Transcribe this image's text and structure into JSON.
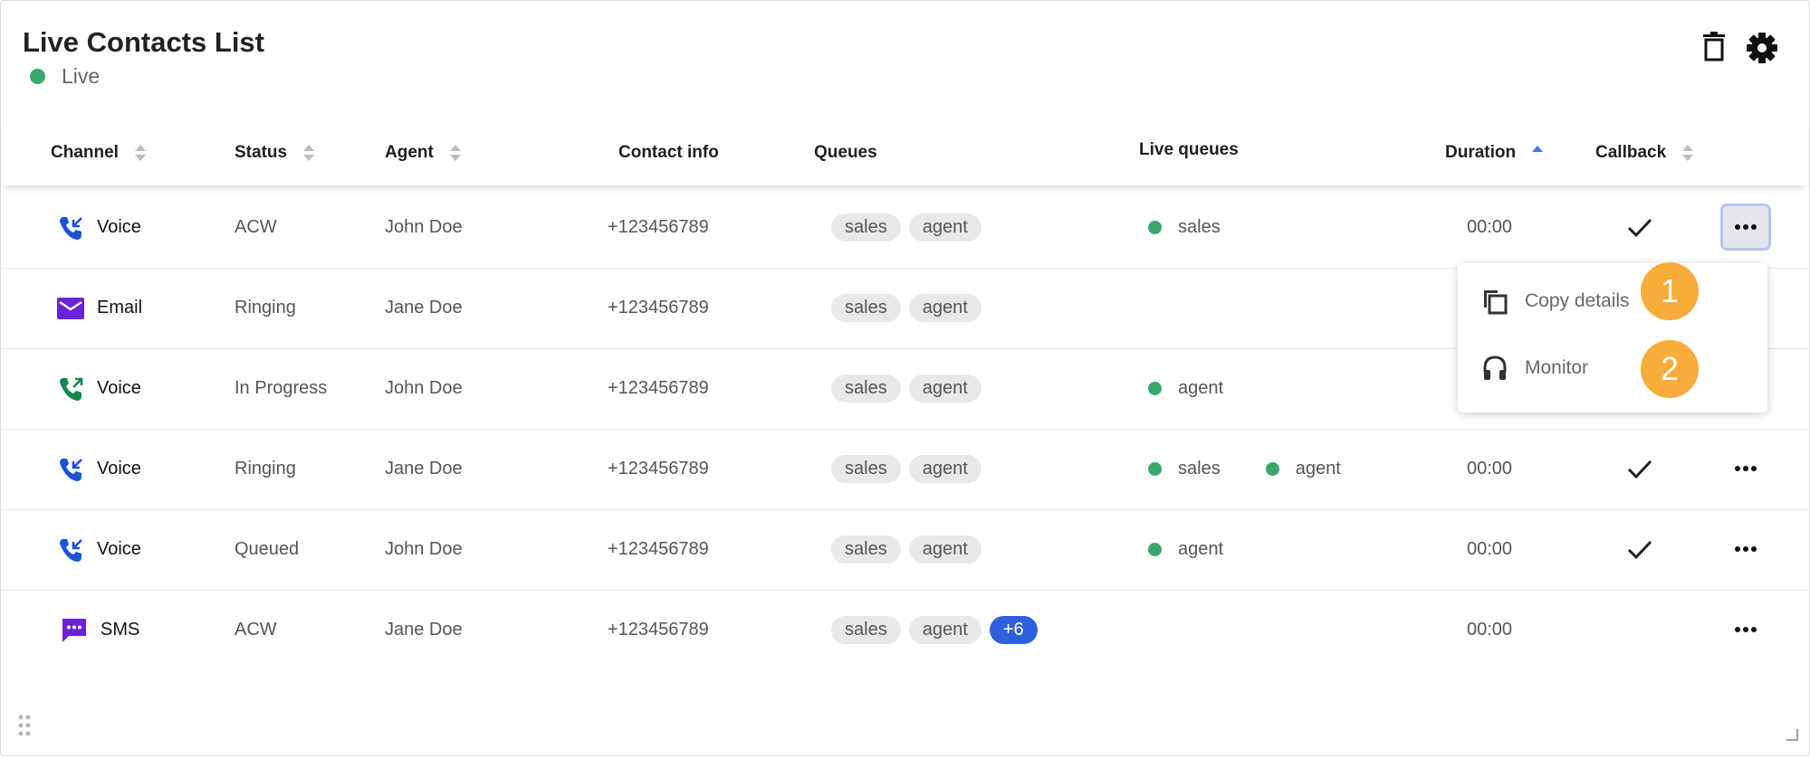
{
  "header": {
    "title": "Live Contacts List",
    "status_label": "Live",
    "status_color": "#3aa76d",
    "icons": [
      "trash-icon",
      "gear-icon"
    ]
  },
  "columns": [
    {
      "label": "Channel",
      "sortable": true,
      "sort": "none"
    },
    {
      "label": "Status",
      "sortable": true,
      "sort": "none"
    },
    {
      "label": "Agent",
      "sortable": true,
      "sort": "none"
    },
    {
      "label": "Contact info",
      "sortable": false
    },
    {
      "label": "Queues",
      "sortable": false
    },
    {
      "label": "Live queues",
      "sortable": false
    },
    {
      "label": "Duration",
      "sortable": true,
      "sort": "ascending"
    },
    {
      "label": "Callback",
      "sortable": true,
      "sort": "none"
    }
  ],
  "rows": [
    {
      "channel": "Voice",
      "channel_icon": "inbound-call-icon",
      "status": "ACW",
      "agent": "John Doe",
      "contact": "+123456789",
      "queues": [
        "sales",
        "agent"
      ],
      "queues_more": "",
      "live_queues": [
        "sales"
      ],
      "duration": "00:00",
      "callback": true
    },
    {
      "channel": "Email",
      "channel_icon": "email-icon",
      "status": "Ringing",
      "agent": "Jane Doe",
      "contact": "+123456789",
      "queues": [
        "sales",
        "agent"
      ],
      "queues_more": "",
      "live_queues": [],
      "duration": "",
      "callback": false
    },
    {
      "channel": "Voice",
      "channel_icon": "outbound-call-icon",
      "status": "In Progress",
      "agent": "John Doe",
      "contact": "+123456789",
      "queues": [
        "sales",
        "agent"
      ],
      "queues_more": "",
      "live_queues": [
        "agent"
      ],
      "duration": "",
      "callback": false
    },
    {
      "channel": "Voice",
      "channel_icon": "inbound-call-icon",
      "status": "Ringing",
      "agent": "Jane Doe",
      "contact": "+123456789",
      "queues": [
        "sales",
        "agent"
      ],
      "queues_more": "",
      "live_queues": [
        "sales",
        "agent"
      ],
      "duration": "00:00",
      "callback": true
    },
    {
      "channel": "Voice",
      "channel_icon": "inbound-call-icon",
      "status": "Queued",
      "agent": "John Doe",
      "contact": "+123456789",
      "queues": [
        "sales",
        "agent"
      ],
      "queues_more": "",
      "live_queues": [
        "agent"
      ],
      "duration": "00:00",
      "callback": true
    },
    {
      "channel": "SMS",
      "channel_icon": "sms-icon",
      "status": "ACW",
      "agent": "Jane Doe",
      "contact": "+123456789",
      "queues": [
        "sales",
        "agent"
      ],
      "queues_more": "+6",
      "live_queues": [],
      "duration": "00:00",
      "callback": false
    }
  ],
  "action_menu": {
    "open_on_row": 0,
    "items": [
      {
        "label": "Copy details",
        "icon": "copy-icon",
        "badge": "1"
      },
      {
        "label": "Monitor",
        "icon": "headset-icon",
        "badge": "2"
      }
    ]
  },
  "colors": {
    "live_dot": "#3aa76d",
    "more_chip": "#2e5fdc",
    "badge": "#f9ac3a",
    "voice_inbound": "#1a53d8",
    "voice_outbound": "#12894a",
    "email": "#6b21d6",
    "sms": "#6b21d6"
  }
}
